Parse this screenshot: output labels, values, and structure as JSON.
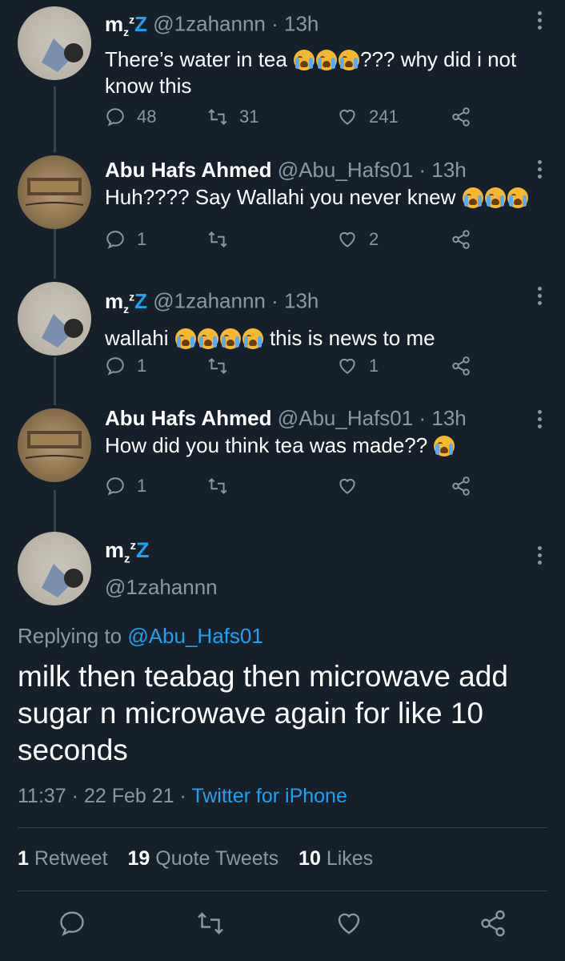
{
  "tweets": [
    {
      "name": "m",
      "name_sub": "z",
      "name_sup": "z",
      "name_z": "Z",
      "handle": "@1zahannn",
      "time": "13h",
      "text_before": "There’s water in tea ",
      "text_after": "??? why did i not know this",
      "emoji_count": 3,
      "replies": "48",
      "retweets": "31",
      "likes": "241"
    },
    {
      "name": "Abu Hafs Ahmed",
      "handle": "@Abu_Hafs01",
      "time": "13h",
      "text_before": "Huh???? Say Wallahi you never knew ",
      "text_after": "",
      "emoji_count": 3,
      "replies": "1",
      "retweets": "",
      "likes": "2"
    },
    {
      "name": "m",
      "name_sub": "z",
      "name_sup": "z",
      "name_z": "Z",
      "handle": "@1zahannn",
      "time": "13h",
      "text_before": "wallahi ",
      "text_after": " this is news to me",
      "emoji_count": 4,
      "replies": "1",
      "retweets": "",
      "likes": "1"
    },
    {
      "name": "Abu Hafs Ahmed",
      "handle": "@Abu_Hafs01",
      "time": "13h",
      "text_before": "How did you think tea was made?? ",
      "text_after": "",
      "emoji_count": 1,
      "replies": "1",
      "retweets": "",
      "likes": ""
    }
  ],
  "separator": "·",
  "main": {
    "name": "m",
    "name_sub": "z",
    "name_sup": "z",
    "name_z": "Z",
    "handle": "@1zahannn",
    "replying_prefix": "Replying to ",
    "replying_to": "@Abu_Hafs01",
    "text": "milk then teabag then microwave add sugar n microwave again for like 10 seconds",
    "time": "11:37",
    "date": "22 Feb 21",
    "source": "Twitter for iPhone",
    "stats": {
      "retweets_count": "1",
      "retweets_label": "Retweet",
      "quotes_count": "19",
      "quotes_label": "Quote Tweets",
      "likes_count": "10",
      "likes_label": "Likes"
    }
  },
  "colors": {
    "background": "#15202b",
    "secondary_text": "#8899a6",
    "link": "#1da1f2",
    "divider": "#38444d"
  },
  "icons": [
    "reply-icon",
    "retweet-icon",
    "like-icon",
    "share-icon",
    "more-icon"
  ]
}
